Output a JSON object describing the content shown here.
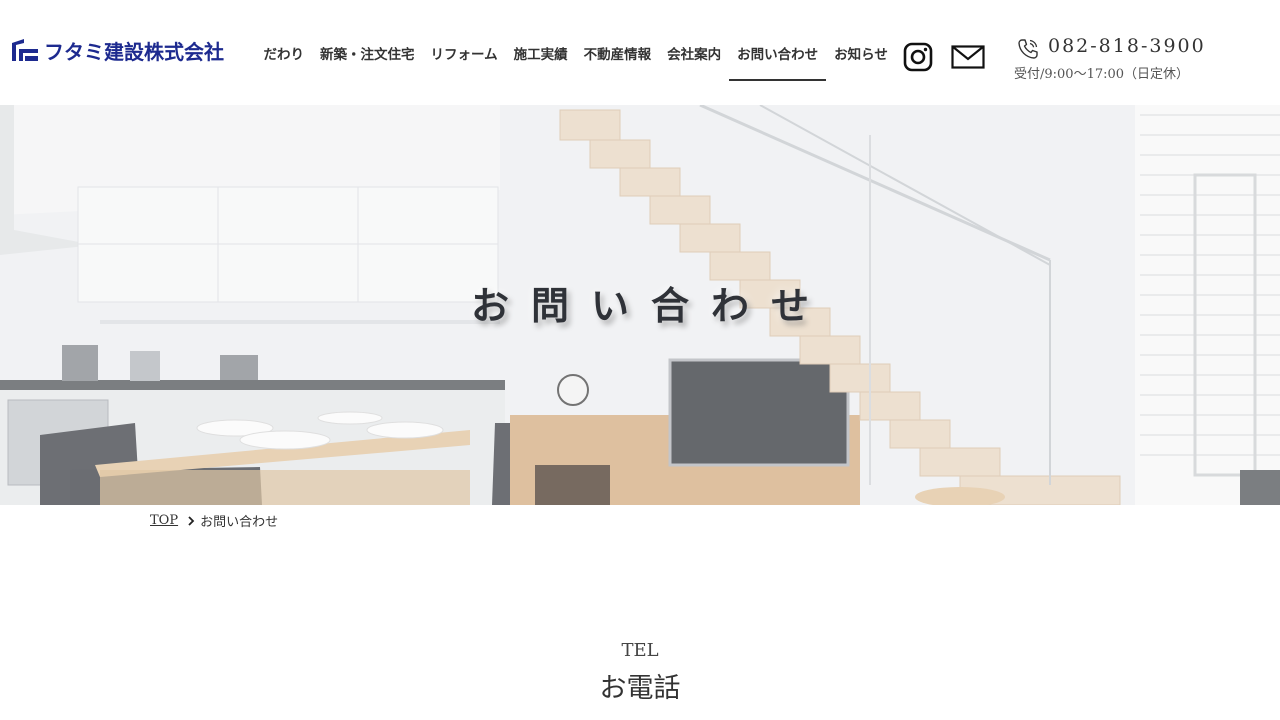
{
  "header": {
    "logo_text": "フタミ建設株式会社",
    "brand_color": "#1d2a8f",
    "nav": [
      {
        "label": "こだわり",
        "active": false
      },
      {
        "label": "新築・注文住宅",
        "active": false
      },
      {
        "label": "リフォーム",
        "active": false
      },
      {
        "label": "施工実績",
        "active": false
      },
      {
        "label": "不動産情報",
        "active": false
      },
      {
        "label": "会社案内",
        "active": false
      },
      {
        "label": "お問い合わせ",
        "active": true
      },
      {
        "label": "お知らせ",
        "active": false
      }
    ],
    "instagram_icon": "instagram-icon",
    "mail_icon": "mail-icon",
    "tel_icon": "phone-icon",
    "tel_number": "082-818-3900",
    "tel_hours": "受付/9:00～17:00（日定休）"
  },
  "hero": {
    "title": "お問い合わせ"
  },
  "breadcrumb": {
    "home": "TOP",
    "current": "お問い合わせ"
  },
  "section": {
    "label_en": "TEL",
    "label_ja": "お電話"
  }
}
